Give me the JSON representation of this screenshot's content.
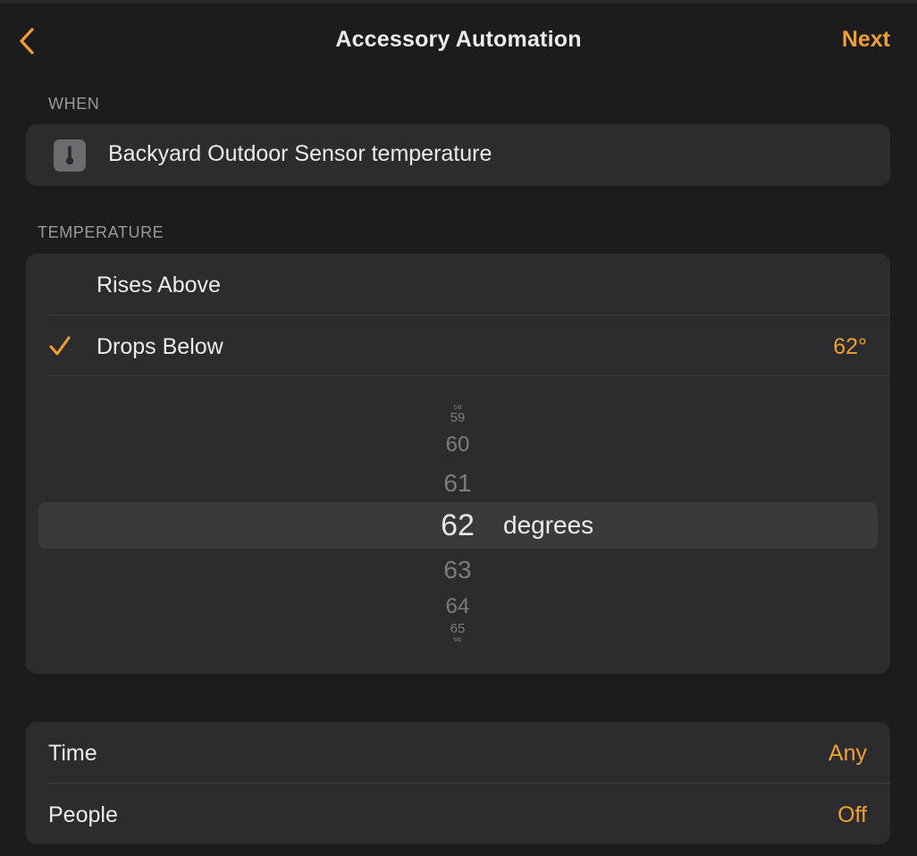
{
  "header": {
    "title": "Accessory Automation",
    "next_label": "Next",
    "back_icon": "chevron-left"
  },
  "when": {
    "section_label": "WHEN",
    "icon": "thermometer",
    "text": "Backyard Outdoor Sensor temperature"
  },
  "temperature": {
    "section_label": "TEMPERATURE",
    "options": [
      {
        "label": "Rises Above",
        "selected": false,
        "value": ""
      },
      {
        "label": "Drops Below",
        "selected": true,
        "value": "62°"
      }
    ],
    "picker": {
      "values": [
        "58",
        "59",
        "60",
        "61",
        "62",
        "63",
        "64",
        "65",
        "66"
      ],
      "selected": "62",
      "unit": "degrees"
    }
  },
  "options": [
    {
      "label": "Time",
      "value": "Any"
    },
    {
      "label": "People",
      "value": "Off"
    }
  ],
  "colors": {
    "accent": "#f0a033",
    "background": "#1c1c1e",
    "card": "#2c2c2e",
    "text": "#ececec",
    "secondary_text": "#9a9a9e"
  }
}
